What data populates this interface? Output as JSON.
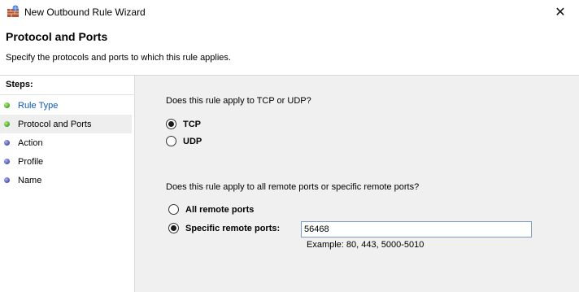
{
  "window": {
    "title": "New Outbound Rule Wizard",
    "close_glyph": "✕"
  },
  "header": {
    "title": "Protocol and Ports",
    "subtitle": "Specify the protocols and ports to which this rule applies."
  },
  "steps": {
    "label": "Steps:",
    "items": [
      {
        "label": "Rule Type",
        "state": "done"
      },
      {
        "label": "Protocol and Ports",
        "state": "current"
      },
      {
        "label": "Action",
        "state": "todo"
      },
      {
        "label": "Profile",
        "state": "todo"
      },
      {
        "label": "Name",
        "state": "todo"
      }
    ]
  },
  "protocol": {
    "question": "Does this rule apply to TCP or UDP?",
    "options": [
      {
        "label": "TCP",
        "selected": true
      },
      {
        "label": "UDP",
        "selected": false
      }
    ]
  },
  "ports": {
    "question": "Does this rule apply to all remote ports or specific remote ports?",
    "options": [
      {
        "label": "All remote ports",
        "selected": false
      },
      {
        "label": "Specific remote ports:",
        "selected": true
      }
    ],
    "value": "56468",
    "example": "Example: 80, 443, 5000-5010"
  },
  "colors": {
    "link": "#0b57c4",
    "step_done": "#3ea81c",
    "step_todo": "#4a4fb8"
  }
}
